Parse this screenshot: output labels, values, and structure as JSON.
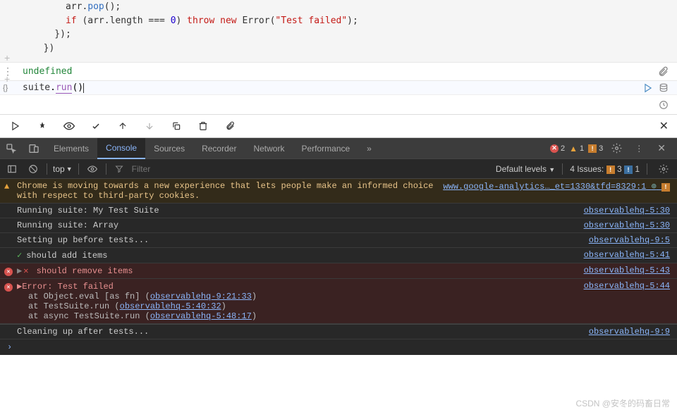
{
  "code": {
    "line1_a": "arr.",
    "line1_b": "pop",
    "line1_c": "();",
    "line2_a": "      ",
    "line2_if": "if",
    "line2_b": " (arr.length === ",
    "line2_num": "0",
    "line2_c": ") ",
    "line2_throw": "throw new",
    "line2_d": " Error(",
    "line2_str": "\"Test failed\"",
    "line2_e": ");",
    "line3": "    });",
    "line4": "  })"
  },
  "output": {
    "value": "undefined"
  },
  "input": {
    "obj": "suite",
    "dot": ".",
    "meth": "run",
    "parens": "()"
  },
  "devtools": {
    "tabs": [
      "Elements",
      "Console",
      "Sources",
      "Recorder",
      "Network",
      "Performance"
    ],
    "active_tab": "Console",
    "err_count": "2",
    "warn_count": "1",
    "issue_count": "3",
    "filter_top": "top",
    "filter_placeholder": "Filter",
    "default_levels": "Default levels",
    "issues_label": "4 Issues:",
    "issues_n1": "3",
    "issues_n2": "1"
  },
  "console": {
    "warn_text": "Chrome is moving towards a new experience that lets people make an informed choice with respect to third-party cookies.",
    "warn_link": "www.google-analytics…_et=1330&tfd=8329:1",
    "rows": [
      {
        "type": "info",
        "text": "Running suite: My Test Suite",
        "src": "observablehq-5:30"
      },
      {
        "type": "info",
        "text": "Running suite: Array",
        "src": "observablehq-5:30"
      },
      {
        "type": "info",
        "text": "Setting up before tests...",
        "src": "observablehq-9:5"
      },
      {
        "type": "pass",
        "text": "should add items",
        "src": "observablehq-5:41"
      },
      {
        "type": "err",
        "text": "should remove items",
        "src": "observablehq-5:43"
      }
    ],
    "err_block": {
      "head": "Error: Test failed",
      "stack": [
        {
          "pre": "    at Object.eval [as fn] (",
          "link": "observablehq-9:21:33",
          "post": ")"
        },
        {
          "pre": "    at TestSuite.run (",
          "link": "observablehq-5:40:32",
          "post": ")"
        },
        {
          "pre": "    at async TestSuite.run (",
          "link": "observablehq-5:48:17",
          "post": ")"
        }
      ],
      "src": "observablehq-5:44"
    },
    "cleanup": {
      "text": "Cleaning up after tests...",
      "src": "observablehq-9:9"
    }
  },
  "watermark": "CSDN @安冬的码畜日常"
}
